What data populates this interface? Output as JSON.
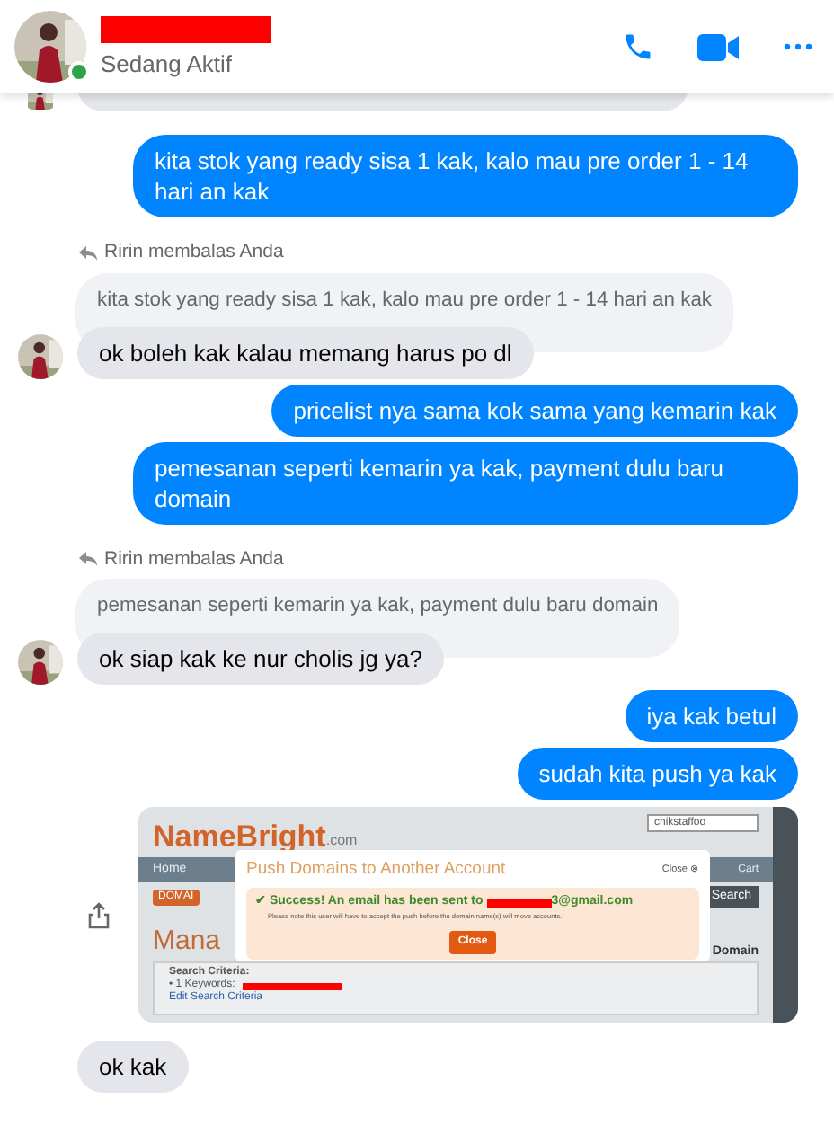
{
  "header": {
    "status": "Sedang Aktif",
    "online": true
  },
  "messages": [
    {
      "kind": "partial",
      "avatar": true
    },
    {
      "kind": "outgoing",
      "text": "kita stok yang ready sisa 1 kak, kalo mau pre order 1 - 14 hari an kak"
    },
    {
      "kind": "reply_label",
      "text": "Ririn membalas Anda"
    },
    {
      "kind": "quoted",
      "text": "kita stok yang ready sisa 1 kak, kalo mau pre order 1 - 14 hari an kak"
    },
    {
      "kind": "incoming",
      "text": "ok boleh kak kalau memang harus po dl",
      "avatar": true
    },
    {
      "kind": "outgoing",
      "text": "pricelist nya sama kok sama yang kemarin kak"
    },
    {
      "kind": "outgoing",
      "text": "pemesanan seperti kemarin ya kak, payment dulu baru domain"
    },
    {
      "kind": "reply_label",
      "text": "Ririn membalas Anda"
    },
    {
      "kind": "quoted",
      "text": "pemesanan seperti kemarin ya kak, payment dulu baru domain"
    },
    {
      "kind": "incoming",
      "text": "ok siap kak ke nur cholis jg ya?",
      "avatar": true
    },
    {
      "kind": "outgoing",
      "text": "iya kak betul"
    },
    {
      "kind": "outgoing",
      "text": "sudah kita push ya kak"
    },
    {
      "shot": {
        "logo": "NameBright",
        "logo_suffix": ".com",
        "account": "chikstaffoo",
        "nav": "Home",
        "cart": "Cart",
        "tab": "DOMAI",
        "search_button": "Search",
        "heading": "Mana",
        "heading_right": "Domain",
        "criteria_title": "Search Criteria:",
        "criteria_item": "• 1 Keywords:",
        "edit_link": "Edit Search Criteria",
        "dialog_title": "Push Domains to Another Account",
        "dialog_close": "Close ⊗",
        "success": "✔ Success! An email has been sent to",
        "email_suffix": "3@gmail.com",
        "note": "Please note this user will have to accept the push before the domain name(s) will move accounts.",
        "button": "Close"
      }
    },
    {
      "kind": "incoming",
      "text": "ok kak",
      "avatar": false
    }
  ]
}
